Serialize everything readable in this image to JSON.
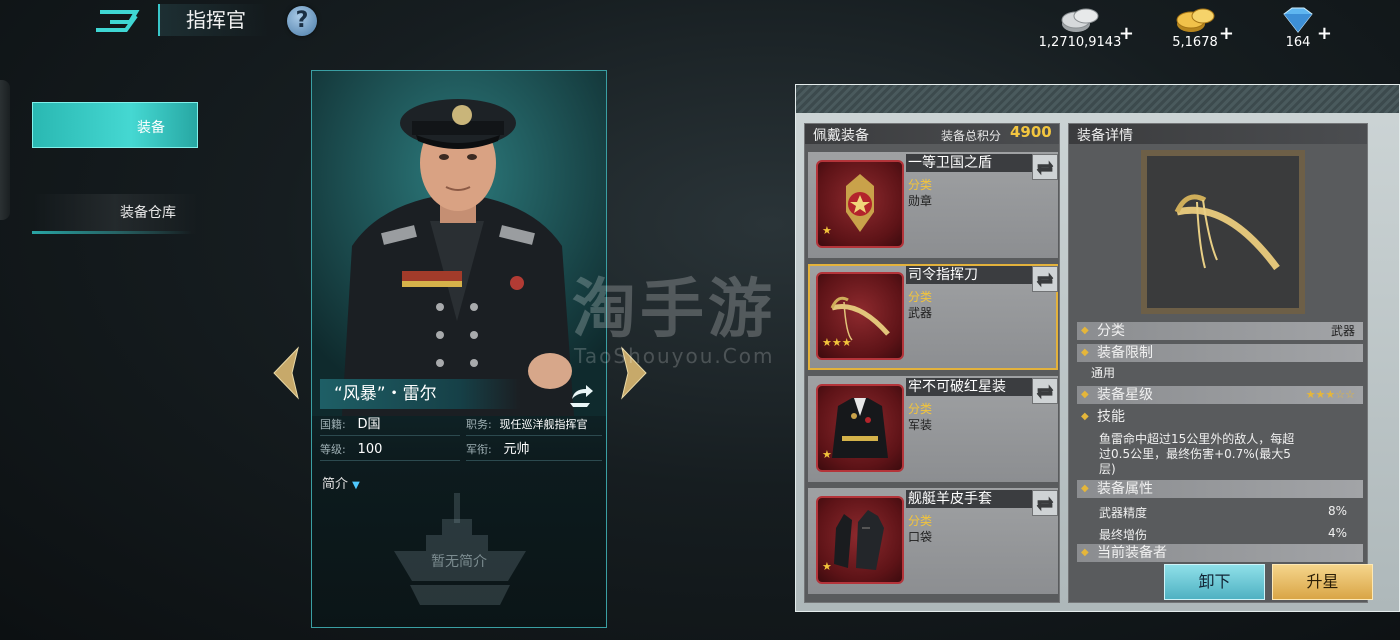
{
  "header": {
    "title": "指挥官",
    "help_label": "?",
    "resources": [
      {
        "icon": "silver-coin-icon",
        "value": "1,2710,9143"
      },
      {
        "icon": "gold-coin-icon",
        "value": "5,1678"
      },
      {
        "icon": "diamond-icon",
        "value": "164"
      }
    ]
  },
  "tabs": {
    "equipment": "装备",
    "warehouse": "装备仓库"
  },
  "commander": {
    "name": "“风暴”・雷尔",
    "info": [
      {
        "key": "国籍:",
        "value": "D国"
      },
      {
        "key": "职务:",
        "value": "现任巡洋舰指挥官"
      },
      {
        "key": "等级:",
        "value": "100"
      },
      {
        "key": "军衔:",
        "value": "元帅"
      }
    ],
    "intro_label": "简介",
    "intro_empty": "暂无简介"
  },
  "watermark": {
    "main": "淘手游",
    "sub": "TaoShouyou.Com"
  },
  "worn": {
    "title": "佩戴装备",
    "score_label": "装备总积分",
    "score": "4900",
    "slots": [
      {
        "name": "一等卫国之盾",
        "cat_label": "分类",
        "cat": "勋章",
        "stars": "★",
        "icon": "medal-icon"
      },
      {
        "name": "司令指挥刀",
        "cat_label": "分类",
        "cat": "武器",
        "stars": "★★★",
        "icon": "saber-icon"
      },
      {
        "name": "牢不可破红星装",
        "cat_label": "分类",
        "cat": "军装",
        "stars": "★",
        "icon": "uniform-icon"
      },
      {
        "name": "舰艇羊皮手套",
        "cat_label": "分类",
        "cat": "口袋",
        "stars": "★",
        "icon": "gloves-icon"
      }
    ]
  },
  "detail": {
    "title": "装备详情",
    "category_label": "分类",
    "category": "武器",
    "limit_label": "装备限制",
    "limit": "通用",
    "stars_label": "装备星级",
    "stars": "★★★☆☆",
    "skill_label": "技能",
    "skill_lines": [
      "鱼雷命中超过15公里外的敌人，每超",
      "过0.5公里，最终伤害+0.7%(最大5",
      "层)"
    ],
    "attr_label": "装备属性",
    "attrs": [
      {
        "name": "武器精度",
        "value": "8%"
      },
      {
        "name": "最终增伤",
        "value": "4%"
      }
    ],
    "owner_label": "当前装备者"
  },
  "buttons": {
    "unequip": "卸下",
    "upstar": "升星"
  }
}
